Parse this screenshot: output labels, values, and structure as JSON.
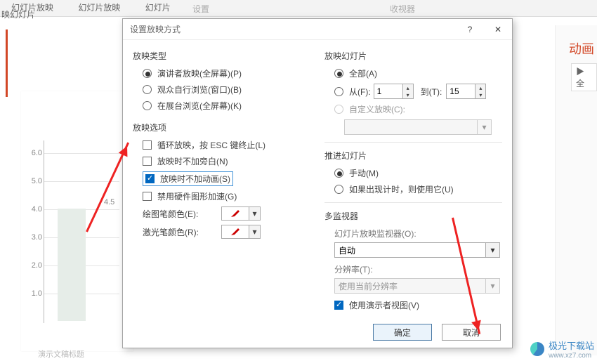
{
  "ribbon": {
    "item1": "幻灯片放映",
    "item2": "幻灯片放映",
    "item3": "幻灯片",
    "group1": "设置",
    "group2": "收视器",
    "leftTab": "映幻灯片"
  },
  "panel": {
    "title": "动画",
    "all": "全"
  },
  "dialog": {
    "title": "设置放映方式",
    "help": "?",
    "close": "✕",
    "ok": "确定",
    "cancel": "取消"
  },
  "showType": {
    "title": "放映类型",
    "r1": "演讲者放映(全屏幕)(P)",
    "r2": "观众自行浏览(窗口)(B)",
    "r3": "在展台浏览(全屏幕)(K)"
  },
  "showOptions": {
    "title": "放映选项",
    "c1": "循环放映，按 ESC 键终止(L)",
    "c2": "放映时不加旁白(N)",
    "c3": "放映时不加动画(S)",
    "c4": "禁用硬件图形加速(G)",
    "penLabel": "绘图笔颜色(E):",
    "laserLabel": "激光笔颜色(R):"
  },
  "showSlides": {
    "title": "放映幻灯片",
    "r1": "全部(A)",
    "r2from": "从(F):",
    "r2to": "到(T):",
    "fromVal": "1",
    "toVal": "15",
    "r3": "自定义放映(C):",
    "customVal": ""
  },
  "advance": {
    "title": "推进幻灯片",
    "r1": "手动(M)",
    "r2": "如果出现计时，则使用它(U)"
  },
  "monitors": {
    "title": "多监视器",
    "monLabel": "幻灯片放映监视器(O):",
    "monVal": "自动",
    "resLabel": "分辨率(T):",
    "resVal": "使用当前分辨率",
    "presenter": "使用演示者视图(V)"
  },
  "doc": {
    "title": "演示文稿标题"
  },
  "chart_data": {
    "type": "bar",
    "categories": [
      ""
    ],
    "values": [
      4.5
    ],
    "bar_label": "4.5",
    "ylim": [
      0,
      6
    ],
    "yticks": [
      1.0,
      2.0,
      3.0,
      4.0,
      5.0,
      6.0
    ],
    "ytick_labels": [
      "1.0",
      "2.0",
      "3.0",
      "4.0",
      "5.0",
      "6.0"
    ]
  },
  "watermark": {
    "name": "极光下载站",
    "url": "www.xz7.com"
  }
}
